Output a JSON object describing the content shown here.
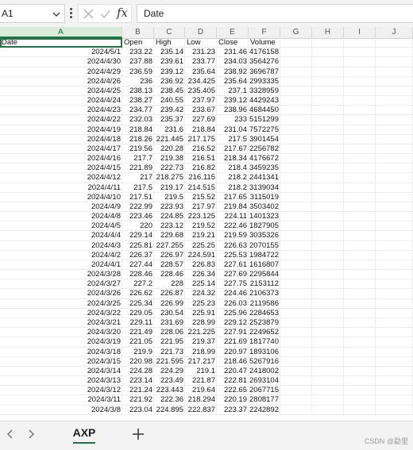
{
  "formula_bar": {
    "name_box": "A1",
    "content": "Date",
    "fx_label": "fx"
  },
  "columns": [
    "A",
    "B",
    "C",
    "D",
    "E",
    "F",
    "G",
    "H",
    "I",
    "J"
  ],
  "headers": [
    "Date",
    "Open",
    "High",
    "Low",
    "Close",
    "Volume"
  ],
  "rows": [
    [
      "2024/5/1",
      "233.22",
      "235.14",
      "231.23",
      "231.46",
      "4176158"
    ],
    [
      "2024/4/30",
      "237.88",
      "239.61",
      "233.77",
      "234.03",
      "3564276"
    ],
    [
      "2024/4/29",
      "236.59",
      "239.12",
      "235.64",
      "238.92",
      "3696787"
    ],
    [
      "2024/4/26",
      "236",
      "236.92",
      "234.425",
      "235.64",
      "2993335"
    ],
    [
      "2024/4/25",
      "238.13",
      "238.45",
      "235.405",
      "237.1",
      "3328959"
    ],
    [
      "2024/4/24",
      "238.27",
      "240.55",
      "237.97",
      "239.12",
      "4429243"
    ],
    [
      "2024/4/23",
      "234.77",
      "239.42",
      "233.67",
      "238.96",
      "4684450"
    ],
    [
      "2024/4/22",
      "232.03",
      "235.37",
      "227.69",
      "233",
      "5151299"
    ],
    [
      "2024/4/19",
      "218.84",
      "231.6",
      "218.84",
      "231.04",
      "7572275"
    ],
    [
      "2024/4/18",
      "218.26",
      "221.445",
      "217.175",
      "217.5",
      "3901454"
    ],
    [
      "2024/4/17",
      "219.56",
      "220.28",
      "216.52",
      "217.67",
      "2256782"
    ],
    [
      "2024/4/16",
      "217.7",
      "219.38",
      "216.51",
      "218.34",
      "4176672"
    ],
    [
      "2024/4/15",
      "221.89",
      "222.73",
      "216.82",
      "218.4",
      "3459235"
    ],
    [
      "2024/4/12",
      "217",
      "218.275",
      "216.115",
      "218.2",
      "2441341"
    ],
    [
      "2024/4/11",
      "217.5",
      "219.17",
      "214.515",
      "218.2",
      "3139034"
    ],
    [
      "2024/4/10",
      "217.51",
      "219.5",
      "215.52",
      "217.65",
      "3115019"
    ],
    [
      "2024/4/9",
      "222.99",
      "223.93",
      "217.97",
      "219.84",
      "3503402"
    ],
    [
      "2024/4/8",
      "223.46",
      "224.85",
      "223.125",
      "224.11",
      "1401323"
    ],
    [
      "2024/4/5",
      "220",
      "223.12",
      "219.52",
      "222.46",
      "1827905"
    ],
    [
      "2024/4/4",
      "229.14",
      "229.68",
      "219.21",
      "219.59",
      "3035326"
    ],
    [
      "2024/4/3",
      "225.81",
      "227.255",
      "225.25",
      "226.63",
      "2070155"
    ],
    [
      "2024/4/2",
      "226.37",
      "226.97",
      "224.591",
      "225.53",
      "1984722"
    ],
    [
      "2024/4/1",
      "227.44",
      "228.57",
      "226.83",
      "227.61",
      "1616807"
    ],
    [
      "2024/3/28",
      "228.46",
      "228.46",
      "226.34",
      "227.69",
      "2295844"
    ],
    [
      "2024/3/27",
      "227.2",
      "228",
      "225.14",
      "227.75",
      "2153112"
    ],
    [
      "2024/3/26",
      "226.62",
      "226.87",
      "224.32",
      "224.46",
      "2106373"
    ],
    [
      "2024/3/25",
      "225.34",
      "226.99",
      "225.23",
      "226.03",
      "2119586"
    ],
    [
      "2024/3/22",
      "229.05",
      "230.54",
      "225.91",
      "225.96",
      "2284653"
    ],
    [
      "2024/3/21",
      "229.11",
      "231.69",
      "228.99",
      "229.12",
      "2523879"
    ],
    [
      "2024/3/20",
      "221.49",
      "228.06",
      "221.225",
      "227.91",
      "2249652"
    ],
    [
      "2024/3/19",
      "221.05",
      "221.95",
      "219.37",
      "221.69",
      "1817740"
    ],
    [
      "2024/3/18",
      "219.9",
      "221.73",
      "218.99",
      "220.97",
      "1893106"
    ],
    [
      "2024/3/15",
      "220.98",
      "221.595",
      "217.217",
      "218.46",
      "5267916"
    ],
    [
      "2024/3/14",
      "224.28",
      "224.29",
      "219.1",
      "220.47",
      "2418002"
    ],
    [
      "2024/3/13",
      "223.14",
      "223.49",
      "221.87",
      "222.81",
      "2693104"
    ],
    [
      "2024/3/12",
      "221.24",
      "223.443",
      "219.64",
      "222.65",
      "2067715"
    ],
    [
      "2024/3/11",
      "221.92",
      "222.36",
      "218.294",
      "220.19",
      "2808177"
    ],
    [
      "2024/3/8",
      "223.04",
      "224.895",
      "222.837",
      "223.37",
      "2242892"
    ]
  ],
  "sheet_tabs": [
    "AXP"
  ],
  "add_sheet_label": "+",
  "watermark": "CSDN @勐里"
}
